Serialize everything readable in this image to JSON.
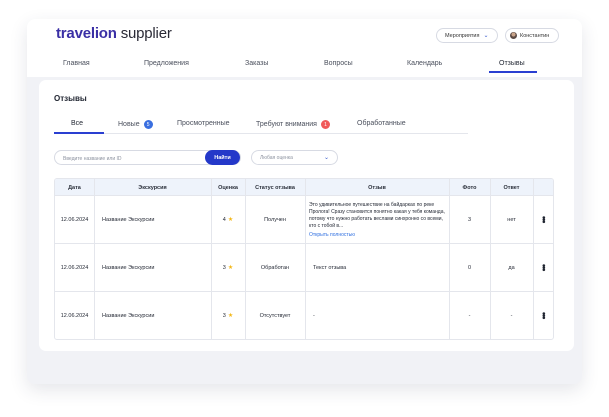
{
  "header": {
    "brand": "travelion",
    "brand_suffix": " supplier",
    "events_label": "Мероприятия",
    "user_name": "Константин"
  },
  "nav": {
    "items": [
      {
        "label": "Главная"
      },
      {
        "label": "Предложения"
      },
      {
        "label": "Заказы"
      },
      {
        "label": "Вопросы"
      },
      {
        "label": "Календарь"
      },
      {
        "label": "Отзывы",
        "active": true
      }
    ]
  },
  "page": {
    "title": "Отзывы",
    "tabs": [
      {
        "label": "Все",
        "active": true
      },
      {
        "label": "Новые",
        "badge": "5"
      },
      {
        "label": "Просмотренные"
      },
      {
        "label": "Требуют внимания",
        "badge": "1"
      },
      {
        "label": "Обработанные"
      }
    ],
    "search_placeholder": "Введите название или ID",
    "find_label": "Найти",
    "rating_placeholder": "Любая оценка"
  },
  "table": {
    "headers": [
      "Дата",
      "Экскурсия",
      "Оценка",
      "Статус отзыва",
      "Отзыв",
      "Фото",
      "Ответ"
    ],
    "rows": [
      {
        "date": "12.06.2024",
        "tour": "Название Экскурсии",
        "rating": "4",
        "status": "Получен",
        "review": "Это удивительное путешествие на байдарках по реке Пролога! Сразу становится понятно какая у тебя команда, потому что нужно работать веслами синхронно со всеми, кто с тобой в...",
        "review_link": "Открыть полностью",
        "photos": "3",
        "reply": "нет"
      },
      {
        "date": "12.06.2024",
        "tour": "Название Экскурсии",
        "rating": "3",
        "status": "Обработан",
        "review": "Текст отзыва",
        "review_link": "",
        "photos": "0",
        "reply": "да"
      },
      {
        "date": "12.06.2024",
        "tour": "Название Экскурсии",
        "rating": "3",
        "status": "Отсутствует",
        "review": "-",
        "review_link": "",
        "photos": "-",
        "reply": "-"
      }
    ]
  },
  "colors": {
    "accent": "#2438c9",
    "brand": "#3a2fa5",
    "star": "#f3b81a",
    "badge_new": "#3a6fe0",
    "badge_attention": "#f05a5a"
  }
}
